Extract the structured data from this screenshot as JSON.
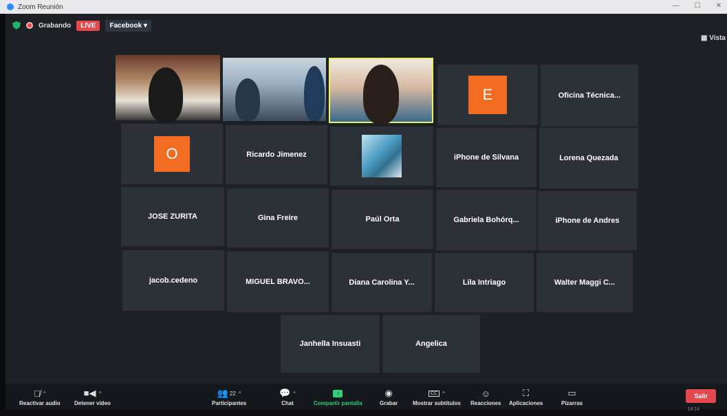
{
  "window": {
    "title": "Zoom Reunión"
  },
  "topbar": {
    "recording_label": "Grabando",
    "live_badge": "LIVE",
    "stream_target": "Facebook ▾",
    "view_label": "Vista"
  },
  "participants": [
    {
      "name": "",
      "type": "video"
    },
    {
      "name": "",
      "type": "video"
    },
    {
      "name": "",
      "type": "video",
      "active_speaker": true
    },
    {
      "name": "",
      "type": "letter",
      "letter": "E"
    },
    {
      "name": "Oficina Técnica...",
      "type": "name"
    },
    {
      "name": "",
      "type": "letter",
      "letter": "O"
    },
    {
      "name": "Ricardo Jimenez",
      "type": "name"
    },
    {
      "name": "",
      "type": "image"
    },
    {
      "name": "iPhone de Silvana",
      "type": "name"
    },
    {
      "name": "Lorena Quezada",
      "type": "name"
    },
    {
      "name": "JOSE ZURITA",
      "type": "name"
    },
    {
      "name": "Gina Freire",
      "type": "name"
    },
    {
      "name": "Paúl Orta",
      "type": "name"
    },
    {
      "name": "Gabriela Bohórq...",
      "type": "name"
    },
    {
      "name": "iPhone de Andres",
      "type": "name"
    },
    {
      "name": "jacob.cedeno",
      "type": "name"
    },
    {
      "name": "MIGUEL BRAVO...",
      "type": "name"
    },
    {
      "name": "Diana Carolina Y...",
      "type": "name"
    },
    {
      "name": "Lila Intriago",
      "type": "name"
    },
    {
      "name": "Walter Maggi C...",
      "type": "name"
    },
    {
      "name": "Janhella Insuasti",
      "type": "name"
    },
    {
      "name": "Angelica",
      "type": "name"
    }
  ],
  "toolbar": {
    "unmute": "Reactivar audio",
    "stop_video": "Detener video",
    "participants": "Participantes",
    "participants_count": "22",
    "chat": "Chat",
    "share": "Compartir pantalla",
    "record": "Grabar",
    "subtitles": "Mostrar subtítulos",
    "reactions": "Reacciones",
    "apps": "Aplicaciones",
    "whiteboards": "Pizarras",
    "leave": "Salir"
  },
  "taskbar": {
    "time": "14:14"
  },
  "colors": {
    "accent_orange": "#f26d21",
    "live_red": "#e5484d",
    "share_green": "#2fd17a",
    "speaker_border": "#e9f26a"
  }
}
